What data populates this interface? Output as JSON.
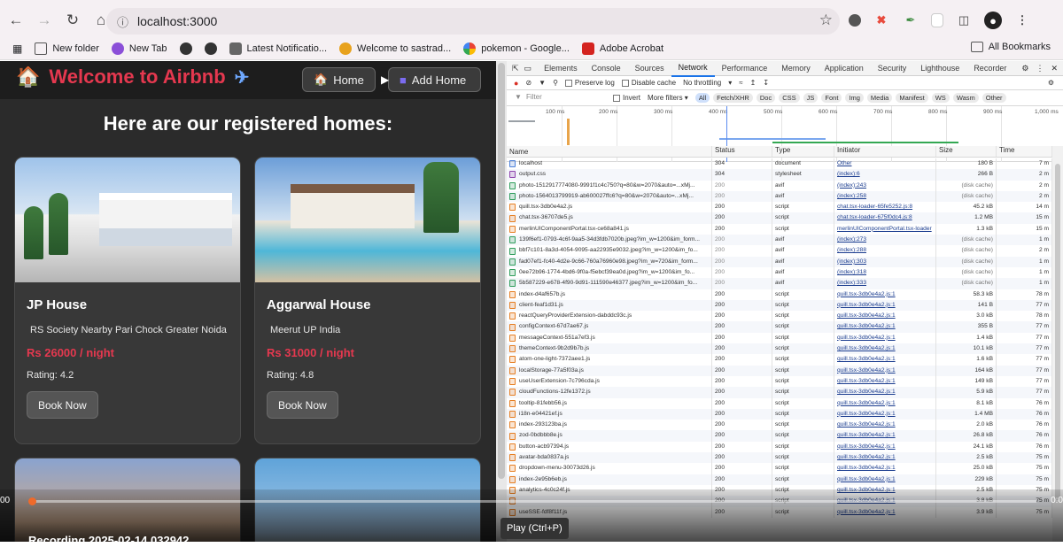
{
  "browser": {
    "url": "localhost:3000",
    "bookmarks": [
      "New folder",
      "New Tab",
      "",
      "",
      "Latest Notificatio...",
      "Welcome to sastrad...",
      "pokemon - Google...",
      "Adobe Acrobat"
    ],
    "all_bookmarks": "All Bookmarks"
  },
  "app": {
    "brand": "Welcome to Airbnb",
    "nav": {
      "home": "Home",
      "add_home": "Add Home"
    },
    "heading": "Here are our registered homes:",
    "homes": [
      {
        "name": "JP House",
        "location": "RS Society Nearby Pari Chock Greater Noida",
        "price": "Rs 26000 / night",
        "rating": "Rating: 4.2",
        "cta": "Book Now"
      },
      {
        "name": "Aggarwal House",
        "location": "Meerut UP India",
        "price": "Rs 31000 / night",
        "rating": "Rating: 4.8",
        "cta": "Book Now"
      }
    ]
  },
  "devtools": {
    "tabs": [
      "Elements",
      "Console",
      "Sources",
      "Network",
      "Performance",
      "Memory",
      "Application",
      "Security",
      "Lighthouse",
      "Recorder"
    ],
    "active_tab": "Network",
    "controls": {
      "preserve_log": "Preserve log",
      "disable_cache": "Disable cache",
      "throttling": "No throttling"
    },
    "filter": {
      "placeholder": "Filter",
      "invert": "Invert",
      "more_filters": "More filters",
      "types": [
        "All",
        "Fetch/XHR",
        "Doc",
        "CSS",
        "JS",
        "Font",
        "Img",
        "Media",
        "Manifest",
        "WS",
        "Wasm",
        "Other"
      ]
    },
    "timeline_ticks": [
      "100 ms",
      "200 ms",
      "300 ms",
      "400 ms",
      "500 ms",
      "600 ms",
      "700 ms",
      "800 ms",
      "900 ms",
      "1,000 ms"
    ],
    "columns": [
      "Name",
      "Status",
      "Type",
      "Initiator",
      "Size",
      "Time"
    ],
    "rows": [
      [
        "localhost",
        "304",
        "document",
        "Other",
        "180 B",
        "7 m"
      ],
      [
        "output.css",
        "304",
        "stylesheet",
        "(index):6",
        "266 B",
        "2 m"
      ],
      [
        "photo-1512917774080-9991f1c4c750?q=80&w=2070&auto=...xMj...",
        "200",
        "avif",
        "(index):243",
        "(disk cache)",
        "2 m"
      ],
      [
        "photo-1564013799919-ab600027ffc6?q=80&w=2070&auto=...xMj...",
        "200",
        "avif",
        "(index):258",
        "(disk cache)",
        "2 m"
      ],
      [
        "quill.tsx-3db0e4a2.js",
        "200",
        "script",
        "chat.tsx-loader-65fe5252.js:8",
        "45.2 kB",
        "14 m"
      ],
      [
        "chat.tsx-36707de5.js",
        "200",
        "script",
        "chat.tsx-loader-675f0dc4.js:8",
        "1.2 MB",
        "15 m"
      ],
      [
        "merlinUIComponentPortal.tsx-ce68a841.js",
        "200",
        "script",
        "merlinUIComponentPortal.tsx-loader",
        "1.3 kB",
        "15 m"
      ],
      [
        "139f6ef1-0793-4c6f-9aa5-34d3fdb7020b.jpeg?im_w=1200&im_form...",
        "200",
        "avif",
        "(index):273",
        "(disk cache)",
        "1 m"
      ],
      [
        "bbf7c101-8a3d-4054-9095-aa22935e9032.jpeg?im_w=1200&im_fo...",
        "200",
        "avif",
        "(index):288",
        "(disk cache)",
        "2 m"
      ],
      [
        "fad07ef1-fc40-4d2e-9c66-760a76960e98.jpeg?im_w=720&im_form...",
        "200",
        "avif",
        "(index):303",
        "(disk cache)",
        "1 m"
      ],
      [
        "0ee72b96-1774-4bd6-9f0a-f5ebcf39ea0d.jpeg?im_w=1200&im_fo...",
        "200",
        "avif",
        "(index):318",
        "(disk cache)",
        "1 m"
      ],
      [
        "5b587229-e678-4f90-9d91-111590e46377.jpeg?im_w=1200&im_fo...",
        "200",
        "avif",
        "(index):333",
        "(disk cache)",
        "1 m"
      ],
      [
        "index-d4af657b.js",
        "200",
        "script",
        "quill.tsx-3db0e4a2.js:1",
        "58.3 kB",
        "78 m"
      ],
      [
        "client-feaf1d31.js",
        "200",
        "script",
        "quill.tsx-3db0e4a2.js:1",
        "141 B",
        "77 m"
      ],
      [
        "reactQueryProviderExtension-dabddc93c.js",
        "200",
        "script",
        "quill.tsx-3db0e4a2.js:1",
        "3.0 kB",
        "78 m"
      ],
      [
        "configContext-67d7ae67.js",
        "200",
        "script",
        "quill.tsx-3db0e4a2.js:1",
        "355 B",
        "77 m"
      ],
      [
        "messageContext-551a7ef3.js",
        "200",
        "script",
        "quill.tsx-3db0e4a2.js:1",
        "1.4 kB",
        "77 m"
      ],
      [
        "themeContext-9b2d9b7b.js",
        "200",
        "script",
        "quill.tsx-3db0e4a2.js:1",
        "10.1 kB",
        "77 m"
      ],
      [
        "atom-one-light-7372aee1.js",
        "200",
        "script",
        "quill.tsx-3db0e4a2.js:1",
        "1.6 kB",
        "77 m"
      ],
      [
        "localStorage-77a5f03a.js",
        "200",
        "script",
        "quill.tsx-3db0e4a2.js:1",
        "164 kB",
        "77 m"
      ],
      [
        "useUserExtension-7c796cda.js",
        "200",
        "script",
        "quill.tsx-3db0e4a2.js:1",
        "149 kB",
        "77 m"
      ],
      [
        "cloudFunctions-12fe1372.js",
        "200",
        "script",
        "quill.tsx-3db0e4a2.js:1",
        "5.9 kB",
        "77 m"
      ],
      [
        "tooltip-81febb56.js",
        "200",
        "script",
        "quill.tsx-3db0e4a2.js:1",
        "8.1 kB",
        "76 m"
      ],
      [
        "i18n-e04421ef.js",
        "200",
        "script",
        "quill.tsx-3db0e4a2.js:1",
        "1.4 MB",
        "76 m"
      ],
      [
        "index-293123ba.js",
        "200",
        "script",
        "quill.tsx-3db0e4a2.js:1",
        "2.0 kB",
        "76 m"
      ],
      [
        "zod-0bdbbb8e.js",
        "200",
        "script",
        "quill.tsx-3db0e4a2.js:1",
        "26.8 kB",
        "76 m"
      ],
      [
        "button-acb97394.js",
        "200",
        "script",
        "quill.tsx-3db0e4a2.js:1",
        "24.1 kB",
        "76 m"
      ],
      [
        "avatar-bda0837a.js",
        "200",
        "script",
        "quill.tsx-3db0e4a2.js:1",
        "2.5 kB",
        "75 m"
      ],
      [
        "dropdown-menu-30073d26.js",
        "200",
        "script",
        "quill.tsx-3db0e4a2.js:1",
        "25.0 kB",
        "75 m"
      ],
      [
        "index-2e95b6eb.js",
        "200",
        "script",
        "quill.tsx-3db0e4a2.js:1",
        "229 kB",
        "75 m"
      ],
      [
        "analytics-4c0c24f.js",
        "200",
        "script",
        "quill.tsx-3db0e4a2.js:1",
        "2.5 kB",
        "75 m"
      ],
      [
        "",
        "200",
        "script",
        "quill.tsx-3db0e4a2.js:1",
        "3.8 kB",
        "75 m"
      ],
      [
        "useSSE-fdf8f11f.js",
        "200",
        "script",
        "quill.tsx-3db0e4a2.js:1",
        "3.9 kB",
        "75 m"
      ]
    ]
  },
  "player": {
    "time_left": "00",
    "time_right": "0:0",
    "tooltip": "Play (Ctrl+P)",
    "title": "Recording 2025-02-14 032942",
    "progress": 0.003
  },
  "colors": {
    "accent": "#e5384f",
    "network_tab": "#1a73e8",
    "progress": "#f06a2a"
  }
}
